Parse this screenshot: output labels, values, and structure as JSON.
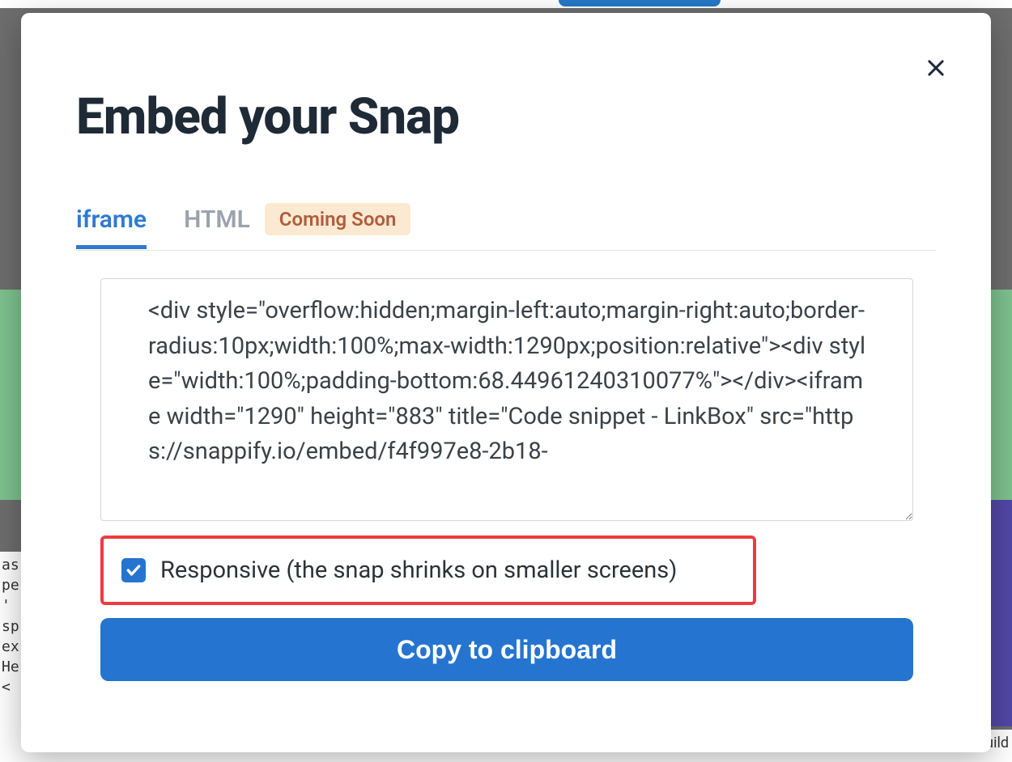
{
  "modal": {
    "title": "Embed your Snap",
    "tabs": {
      "iframe": "iframe",
      "html": "HTML",
      "badge": "Coming Soon"
    },
    "code": "<div style=\"overflow:hidden;margin-left:auto;margin-right:auto;border-radius:10px;width:100%;max-width:1290px;position:relative\"><div style=\"width:100%;padding-bottom:68.44961240310077%\"></div><iframe width=\"1290\" height=\"883\" title=\"Code snippet - LinkBox\" src=\"https://snappify.io/embed/f4f997e8-2b18-",
    "checkbox_label": "Responsive (the snap shrinks on smaller screens)",
    "checkbox_checked": true,
    "copy_button": "Copy to clipboard"
  },
  "background": {
    "code_snippet_left": "as\npe\n' \nsp\nex\nHe\n<",
    "bottom_text": "How we leverage supabase to build"
  }
}
